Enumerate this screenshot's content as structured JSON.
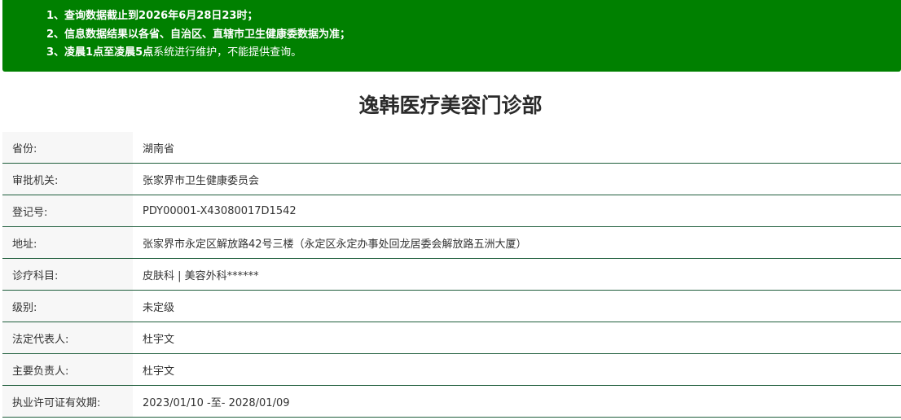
{
  "notice": {
    "line1_prefix": "1、查询数据截止到",
    "line1_bold": "2026年6月28日23时",
    "line1_suffix": "；",
    "line2": "2、信息数据结果以各省、自治区、直辖市卫生健康委数据为准；",
    "line3_prefix": "3、",
    "line3_bold": "凌晨1点至凌晨5点",
    "line3_suffix": "系统进行维护，不能提供查询。"
  },
  "title": "逸韩医疗美容门诊部",
  "rows": [
    {
      "label": "省份:",
      "value": "湖南省"
    },
    {
      "label": "审批机关:",
      "value": "张家界市卫生健康委员会"
    },
    {
      "label": "登记号:",
      "value": "PDY00001-X43080017D1542"
    },
    {
      "label": "地址:",
      "value": "张家界市永定区解放路42号三楼（永定区永定办事处回龙居委会解放路五洲大厦）"
    },
    {
      "label": "诊疗科目:",
      "value": "皮肤科 | 美容外科******"
    },
    {
      "label": "级别:",
      "value": "未定级"
    },
    {
      "label": "法定代表人:",
      "value": "杜宇文"
    },
    {
      "label": "主要负责人:",
      "value": "杜宇文"
    },
    {
      "label": "执业许可证有效期:",
      "value": "2023/01/10 -至- 2028/01/09"
    }
  ],
  "colors": {
    "notice_bg": "#008000",
    "row_border": "#1f5e3c",
    "label_bg": "#f7f7f7"
  }
}
